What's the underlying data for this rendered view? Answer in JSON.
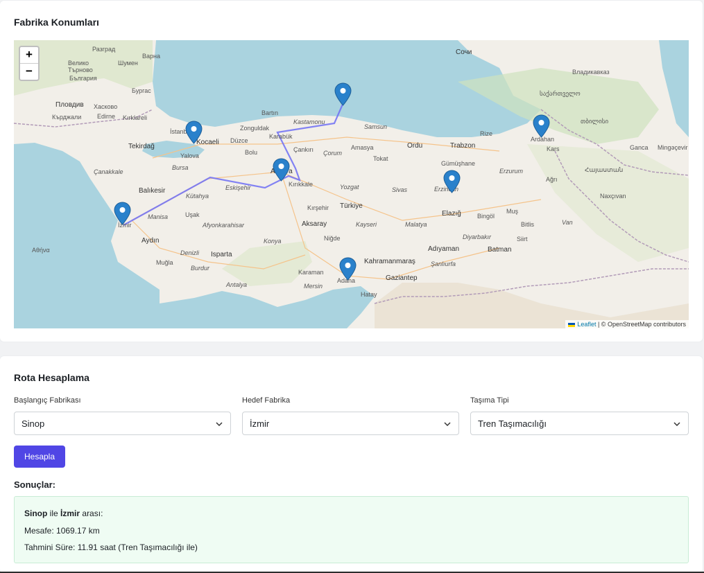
{
  "map_section": {
    "title": "Fabrika Konumları",
    "zoom_in": "+",
    "zoom_out": "−",
    "attribution_link": "Leaflet",
    "attribution_text": "| © OpenStreetMap contributors",
    "labels": [
      "Варна",
      "Шумен",
      "Велико Търново",
      "Разград",
      "България",
      "Пловдив",
      "Хасково",
      "Кърджали",
      "Edirne",
      "Kırklareli",
      "Бургас",
      "İstanbul",
      "Tekirdağ",
      "Kocaeli",
      "Yalova",
      "Düzce",
      "Bolu",
      "Zonguldak",
      "Karabük",
      "Bartın",
      "Kastamonu",
      "Samsun",
      "Çankırı",
      "Çorum",
      "Amasya",
      "Ordu",
      "Trabzon",
      "Rize",
      "Tokat",
      "Gümüşhane",
      "Erzincan",
      "Erzurum",
      "Ardahan",
      "Kars",
      "Ağrı",
      "Ankara",
      "Kırıkkale",
      "Eskişehir",
      "Kütahya",
      "Bursa",
      "Balıkesir",
      "Çanakkale",
      "Yozgat",
      "Sivas",
      "Kırşehir",
      "Türkiye",
      "Aksaray",
      "Kayseri",
      "Malatya",
      "Elazığ",
      "Bingöl",
      "Bitlis",
      "Van",
      "Muş",
      "Siirt",
      "Batman",
      "Diyarbakır",
      "Adıyaman",
      "Şanlıurfa",
      "Kahramanmaraş",
      "Gaziantep",
      "Hatay",
      "Adana",
      "Mersin",
      "Karaman",
      "Konya",
      "Niğde",
      "Isparta",
      "Afyonkarahisar",
      "Uşak",
      "Manisa",
      "Aydın",
      "Muğla",
      "Denizli",
      "Antalya",
      "Burdur",
      "Сочи",
      "Владикавказ",
      "Kocaeli",
      "Ganca",
      "Mingəçevir",
      "Naxçıvan",
      "Αθήνα",
      "საქართველო",
      "თბილისი",
      "Հայաստան",
      "İzmir"
    ],
    "markers": [
      "Sinop",
      "Kocaeli",
      "Ankara",
      "Erzincan",
      "Ardahan",
      "İzmir",
      "Adana"
    ],
    "colors": {
      "route": "#6f6ff5",
      "marker": "#2a81cb",
      "sea": "#aad3df",
      "land": "#f2efe9"
    }
  },
  "route_section": {
    "title": "Rota Hesaplama",
    "start_label": "Başlangıç Fabrikası",
    "start_value": "Sinop",
    "target_label": "Hedef Fabrika",
    "target_value": "İzmir",
    "transport_label": "Taşıma Tipi",
    "transport_value": "Tren Taşımacılığı",
    "calculate_button": "Hesapla",
    "results_title": "Sonuçlar:",
    "results": {
      "from": "Sinop",
      "connector": "ile",
      "to": "İzmir",
      "suffix": "arası:",
      "distance_label": "Mesafe:",
      "distance_value": "1069.17 km",
      "duration_label": "Tahmini Süre:",
      "duration_value": "11.91 saat (Tren Taşımacılığı ile)"
    }
  }
}
